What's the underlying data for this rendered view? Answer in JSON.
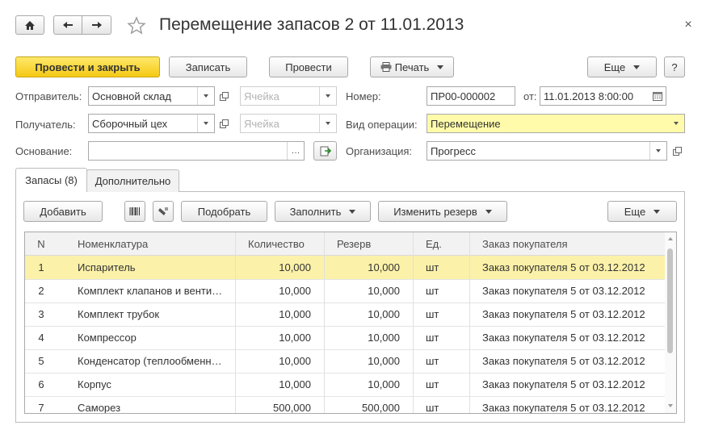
{
  "header": {
    "title": "Перемещение запасов 2 от 11.01.2013",
    "close_symbol": "×"
  },
  "toolbar": {
    "post_close_label": "Провести и закрыть",
    "save_label": "Записать",
    "post_label": "Провести",
    "print_label": "Печать",
    "more_label": "Еще",
    "help_label": "?"
  },
  "form": {
    "sender_label": "Отправитель:",
    "sender_value": "Основной склад",
    "sender_cell_placeholder": "Ячейка",
    "receiver_label": "Получатель:",
    "receiver_value": "Сборочный цех",
    "receiver_cell_placeholder": "Ячейка",
    "basis_label": "Основание:",
    "basis_value": "",
    "number_label": "Номер:",
    "number_value": "ПР00-000002",
    "date_label": "от:",
    "date_value": "11.01.2013  8:00:00",
    "operation_label": "Вид операции:",
    "operation_value": "Перемещение",
    "org_label": "Организация:",
    "org_value": "Прогресс"
  },
  "tabs": [
    {
      "label": "Запасы (8)"
    },
    {
      "label": "Дополнительно"
    }
  ],
  "table_toolbar": {
    "add_label": "Добавить",
    "pick_label": "Подобрать",
    "fill_label": "Заполнить",
    "change_reserve_label": "Изменить резерв",
    "more_label": "Еще"
  },
  "table": {
    "columns": [
      "N",
      "Номенклатура",
      "Количество",
      "Резерв",
      "Ед.",
      "Заказ покупателя"
    ],
    "rows": [
      [
        "1",
        "Испаритель",
        "10,000",
        "10,000",
        "шт",
        "Заказ покупателя 5 от 03.12.2012"
      ],
      [
        "2",
        "Комплект клапанов и венти…",
        "10,000",
        "10,000",
        "шт",
        "Заказ покупателя 5 от 03.12.2012"
      ],
      [
        "3",
        "Комплект трубок",
        "10,000",
        "10,000",
        "шт",
        "Заказ покупателя 5 от 03.12.2012"
      ],
      [
        "4",
        "Компрессор",
        "10,000",
        "10,000",
        "шт",
        "Заказ покупателя 5 от 03.12.2012"
      ],
      [
        "5",
        "Конденсатор (теплообменн…",
        "10,000",
        "10,000",
        "шт",
        "Заказ покупателя 5 от 03.12.2012"
      ],
      [
        "6",
        "Корпус",
        "10,000",
        "10,000",
        "шт",
        "Заказ покупателя 5 от 03.12.2012"
      ],
      [
        "7",
        "Саморез",
        "500,000",
        "500,000",
        "шт",
        "Заказ покупателя 5 от 03.12.2012"
      ]
    ]
  },
  "colors": {
    "primary_button": "#f5c915",
    "selected_row": "#fbf1a9",
    "highlight_field": "#fffbaa"
  }
}
